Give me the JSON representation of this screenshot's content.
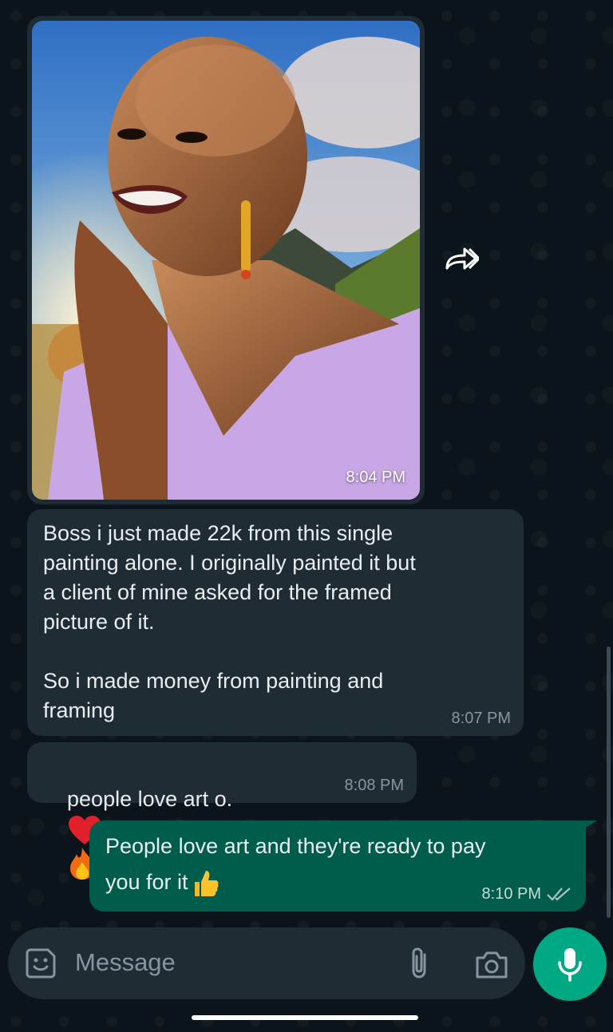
{
  "messages": [
    {
      "type": "image",
      "direction": "in",
      "time": "8:04 PM",
      "image": "portrait-painting"
    },
    {
      "type": "text",
      "direction": "in",
      "lines": "Boss i just made 22k from this single\npainting alone. I originally painted it but\na client of mine asked for the framed\npicture of it.\n\nSo i made money from painting and\nframing",
      "time": "8:07 PM"
    },
    {
      "type": "text",
      "direction": "in",
      "text": "people love art o.",
      "emojis": [
        "red-heart",
        "fire"
      ],
      "time": "8:08 PM"
    },
    {
      "type": "text",
      "direction": "out",
      "lines": "People love art and they're ready to pay\nyou for it",
      "emojis": [
        "thumbs-up"
      ],
      "time": "8:10 PM",
      "status": "read-double-tick"
    }
  ],
  "input": {
    "placeholder": "Message"
  },
  "icons": {
    "forward": "forward-icon",
    "sticker": "sticker-icon",
    "attach": "paperclip-icon",
    "camera": "camera-icon",
    "mic": "microphone-icon"
  },
  "colors": {
    "incoming": "#1f2c34",
    "outgoing": "#005c4b",
    "accent": "#00a884",
    "background": "#0b141a"
  }
}
